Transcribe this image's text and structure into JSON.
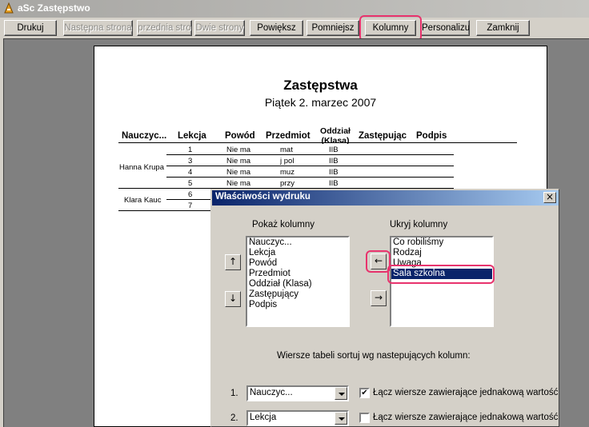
{
  "window": {
    "title": "aSc Zastępstwo",
    "accent": "#e8336d"
  },
  "toolbar": {
    "print": "Drukuj",
    "next_page": "Następna strona",
    "prev_page": "przednia stro",
    "two_pages": "Dwie strony",
    "zoom_in": "Powiększ",
    "zoom_out": "Pomniejsz",
    "columns": "Kolumny",
    "personalize": "Personalizuj",
    "close": "Zamknij"
  },
  "document": {
    "title": "Zastępstwa",
    "subtitle": "Piątek 2. marzec 2007",
    "headers": [
      "Nauczyc...",
      "Lekcja",
      "Powód",
      "Przedmiot",
      "Oddział (Klasa)",
      "Zastępując",
      "Podpis"
    ],
    "rows": [
      {
        "teacher": "",
        "lesson": "1",
        "reason": "Nie ma",
        "subject": "mat",
        "class": "IIB"
      },
      {
        "teacher": "Hanna Krupa",
        "lesson": "3",
        "reason": "Nie ma",
        "subject": "j pol",
        "class": "IIB"
      },
      {
        "teacher": "",
        "lesson": "4",
        "reason": "Nie ma",
        "subject": "muz",
        "class": "IIB"
      },
      {
        "teacher": "",
        "lesson": "5",
        "reason": "Nie ma",
        "subject": "przy",
        "class": "IIB"
      },
      {
        "teacher": "Klara Kauc",
        "lesson": "6",
        "reason": "",
        "subject": "",
        "class": ""
      },
      {
        "teacher": "",
        "lesson": "7",
        "reason": "",
        "subject": "",
        "class": ""
      }
    ]
  },
  "dialog": {
    "title": "Właściwości wydruku",
    "close_glyph": "×",
    "show_label": "Pokaż kolumny",
    "hide_label": "Ukryj kolumny",
    "show_items": [
      "Nauczyc...",
      "Lekcja",
      "Powód",
      "Przedmiot",
      "Oddział (Klasa)",
      "Zastępujący",
      "Podpis"
    ],
    "hide_items": [
      "Co robiliśmy",
      "Rodzaj",
      "Uwaga",
      "Sala szkolna"
    ],
    "selected_hide_item": "Sala szkolna",
    "up_glyph": "↑",
    "down_glyph": "↓",
    "move_left_glyph": "←",
    "move_right_glyph": "→",
    "sort_label": "Wiersze tabeli sortuj wg nastepujących kolumn:",
    "sort": [
      {
        "num": "1.",
        "value": "Nauczyc...",
        "merge_label": "Łącz wiersze zawierające jednakową wartość",
        "checked": true,
        "check_glyph": "✔"
      },
      {
        "num": "2.",
        "value": "Lekcja",
        "merge_label": "Łącz wiersze zawierające jednakową wartość",
        "checked": false,
        "check_glyph": ""
      }
    ]
  }
}
